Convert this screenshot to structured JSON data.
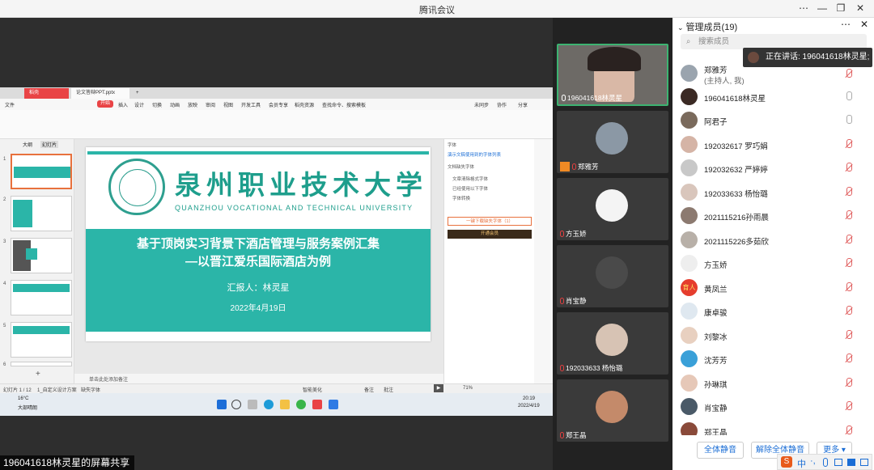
{
  "window": {
    "title": "腾讯会议"
  },
  "share": {
    "label": "196041618林灵星的屏幕共享",
    "wps": {
      "tab_home": "稻壳",
      "tab_file": "论文答辩PPT.pptx",
      "menu": [
        "文件",
        "开始",
        "插入",
        "设计",
        "切换",
        "动画",
        "放映",
        "审阅",
        "视图",
        "开发工具",
        "会员专享",
        "稻壳资源"
      ],
      "search_hint": "查找命令、搜索模板",
      "sync": "未同步",
      "collab": "协作",
      "share": "分享",
      "thumb_tabs": [
        "大纲",
        "幻灯片"
      ],
      "right_pane": {
        "title": "字体",
        "line1": "演示文稿使用到的字体列表",
        "line2": "文档缺失字体",
        "line3": "文章清除格式字体",
        "line4": "已经使用以下字体",
        "line5": "字体转换",
        "btn_download": "一键下载缺失字体（1）",
        "btn_vip": "开通会员"
      },
      "notes": "单击此处添加备注",
      "status_left": "幻灯片 1 / 12",
      "status_theme": "1_自定义设计方案",
      "status_font": "缺失字体",
      "zoom": "71%",
      "smart": "智能美化",
      "remark": "备注",
      "comment": "批注",
      "weather": "16°C",
      "weather_desc": "大部晴朗",
      "clock_time": "20:19",
      "clock_date": "2022/4/19"
    },
    "slide": {
      "school_cn": "泉州职业技术大学",
      "school_en": "QUANZHOU VOCATIONAL AND TECHNICAL UNIVERSITY",
      "title_line1": "基于顶岗实习背景下酒店管理与服务案例汇集",
      "title_line2": "—以晋江爱乐国际酒店为例",
      "reporter": "汇报人：林灵星",
      "date": "2022年4月19日"
    },
    "thumbnails": [
      "1",
      "2",
      "3",
      "4",
      "5",
      "6"
    ]
  },
  "videos": [
    {
      "name": "196041618林灵星",
      "speaking": true
    },
    {
      "name": "郑雅芳",
      "speaking": false
    },
    {
      "name": "方玉娇",
      "speaking": false
    },
    {
      "name": "肖宝静",
      "speaking": false
    },
    {
      "name": "192033633 杨怡璐",
      "speaking": false
    },
    {
      "name": "郑王晶",
      "speaking": false
    }
  ],
  "members_panel": {
    "title": "管理成员(19)",
    "search_placeholder": "搜索成员",
    "speaking_tip": "正在讲话: 196041618林灵星;",
    "members": [
      {
        "name": "郑雅芳",
        "role": "(主持人, 我)",
        "mic": "off"
      },
      {
        "name": "196041618林灵星",
        "role": "",
        "mic": "on"
      },
      {
        "name": "阿君子",
        "role": "",
        "mic": "on"
      },
      {
        "name": "192032617 罗巧娟",
        "role": "",
        "mic": "off"
      },
      {
        "name": "192032632 严婷婷",
        "role": "",
        "mic": "off"
      },
      {
        "name": "192033633 杨怡璐",
        "role": "",
        "mic": "off"
      },
      {
        "name": "2021115216孙雨晨",
        "role": "",
        "mic": "off"
      },
      {
        "name": "2021115226多茹欣",
        "role": "",
        "mic": "off"
      },
      {
        "name": "方玉娇",
        "role": "",
        "mic": "off"
      },
      {
        "name": "黄凤兰",
        "role": "",
        "mic": "off"
      },
      {
        "name": "康卓骏",
        "role": "",
        "mic": "off"
      },
      {
        "name": "刘黎冰",
        "role": "",
        "mic": "off"
      },
      {
        "name": "沈芳芳",
        "role": "",
        "mic": "off"
      },
      {
        "name": "孙琳琪",
        "role": "",
        "mic": "off"
      },
      {
        "name": "肖宝静",
        "role": "",
        "mic": "off"
      },
      {
        "name": "郑王晶",
        "role": "",
        "mic": "off"
      }
    ],
    "btn_mute_all": "全体静音",
    "btn_unmute_all": "解除全体静音",
    "btn_more": "更多"
  },
  "ime": {
    "label": "中"
  },
  "colors": {
    "teal": "#2bb5a8",
    "wps_red": "#e94345",
    "speaking_border": "#3cb371",
    "mic_off": "#e06060"
  }
}
